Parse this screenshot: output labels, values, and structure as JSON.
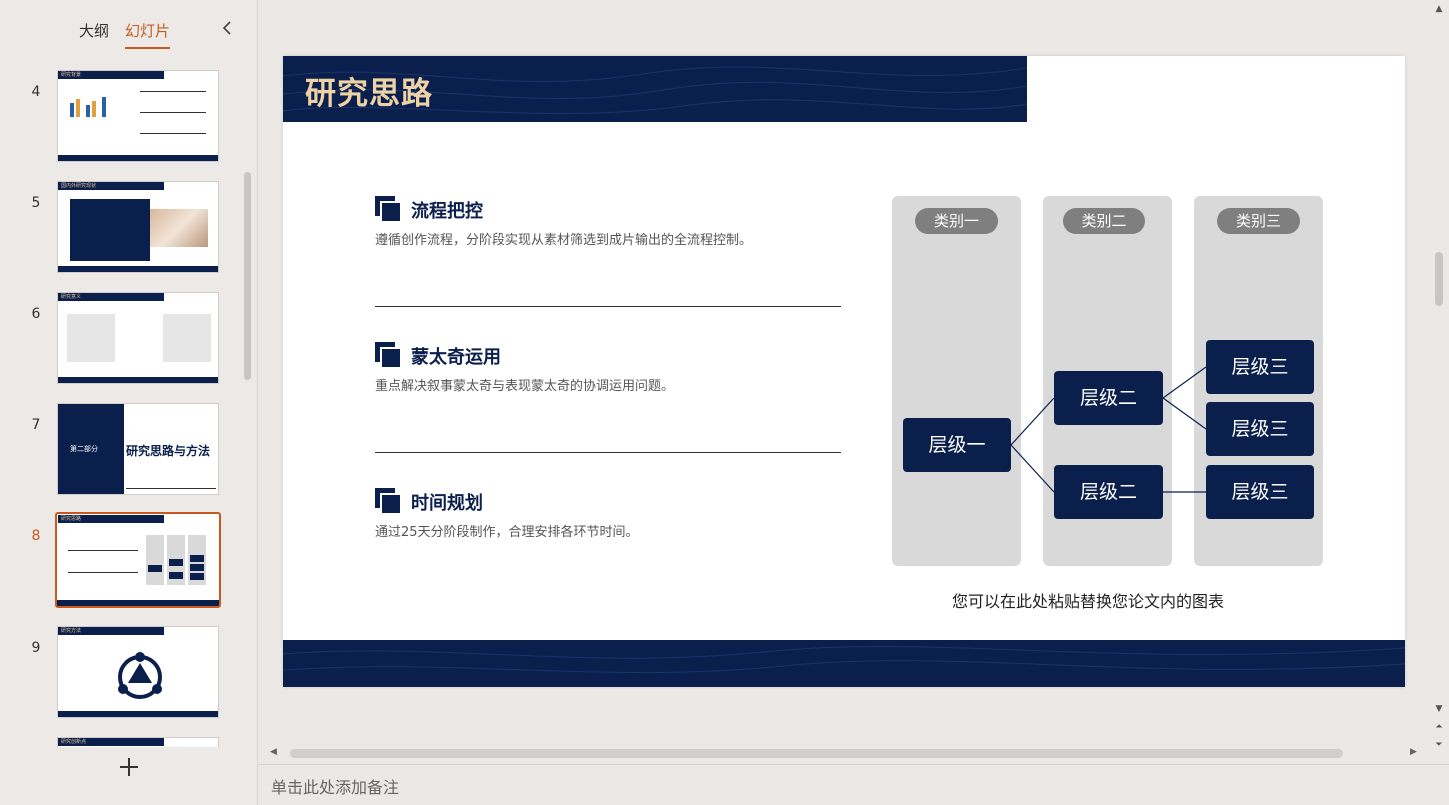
{
  "left_panel": {
    "tab_outline": "大纲",
    "tab_slides": "幻灯片",
    "collapse_icon": "chevron-left",
    "add_icon": "plus"
  },
  "thumbnails": [
    {
      "number": "4",
      "title": "研究背景"
    },
    {
      "number": "5",
      "title": "国内外研究现状"
    },
    {
      "number": "6",
      "title": "研究意义"
    },
    {
      "number": "7",
      "part": "第二部分",
      "heading": "研究思路与方法"
    },
    {
      "number": "8",
      "title": "研究思路"
    },
    {
      "number": "9",
      "title": "研究方法"
    },
    {
      "number": "10",
      "title": "研究创新点"
    }
  ],
  "slide": {
    "title": "研究思路",
    "sections": [
      {
        "title": "流程把控",
        "desc": "遵循创作流程，分阶段实现从素材筛选到成片输出的全流程控制。"
      },
      {
        "title": "蒙太奇运用",
        "desc": "重点解决叙事蒙太奇与表现蒙太奇的协调运用问题。"
      },
      {
        "title": "时间规划",
        "desc": "通过25天分阶段制作，合理安排各环节时间。"
      }
    ],
    "categories": [
      "类别一",
      "类别二",
      "类别三"
    ],
    "nodes": {
      "level1": "层级一",
      "level2": [
        "层级二",
        "层级二"
      ],
      "level3": [
        "层级三",
        "层级三",
        "层级三"
      ]
    },
    "caption": "您可以在此处粘贴替换您论文内的图表"
  },
  "notes": {
    "placeholder": "单击此处添加备注"
  },
  "colors": {
    "navy": "#0b1f4d",
    "gold": "#ecd2a4",
    "accent": "#c65a1e",
    "gray_column": "#d9d9d9",
    "gray_pill": "#7f7f7f"
  }
}
